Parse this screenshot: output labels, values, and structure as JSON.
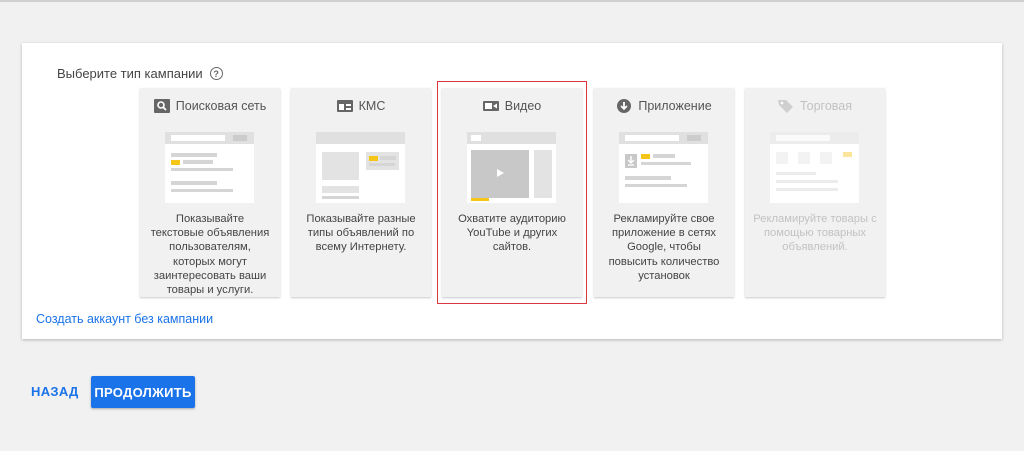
{
  "section_title": "Выберите тип кампании",
  "help_icon_glyph": "?",
  "campaign_types": [
    {
      "label": "Поисковая сеть",
      "icon": "search-icon",
      "description": "Показывайте текстовые объявления пользователям, которых могут заинтересовать ваши товары и услуги.",
      "disabled": false
    },
    {
      "label": "КМС",
      "icon": "display-network-icon",
      "description": "Показывайте разные типы объявлений по всему Интернету.",
      "disabled": false
    },
    {
      "label": "Видео",
      "icon": "video-camera-icon",
      "description": "Охватите аудиторию YouTube и других сайтов.",
      "disabled": false,
      "selected": true
    },
    {
      "label": "Приложение",
      "icon": "app-download-icon",
      "description": "Рекламируйте свое приложение в сетях Google, чтобы повысить количество установок",
      "disabled": false
    },
    {
      "label": "Торговая",
      "icon": "shopping-tag-icon",
      "description": "Рекламируйте товары с помощью товарных объявлений.",
      "disabled": true
    }
  ],
  "create_without_campaign": "Создать аккаунт без кампании",
  "buttons": {
    "back": "НАЗАД",
    "continue": "ПРОДОЛЖИТЬ"
  },
  "colors": {
    "accent": "#1a73e8",
    "selected_border": "#d9393e",
    "highlight": "#f5c518"
  }
}
